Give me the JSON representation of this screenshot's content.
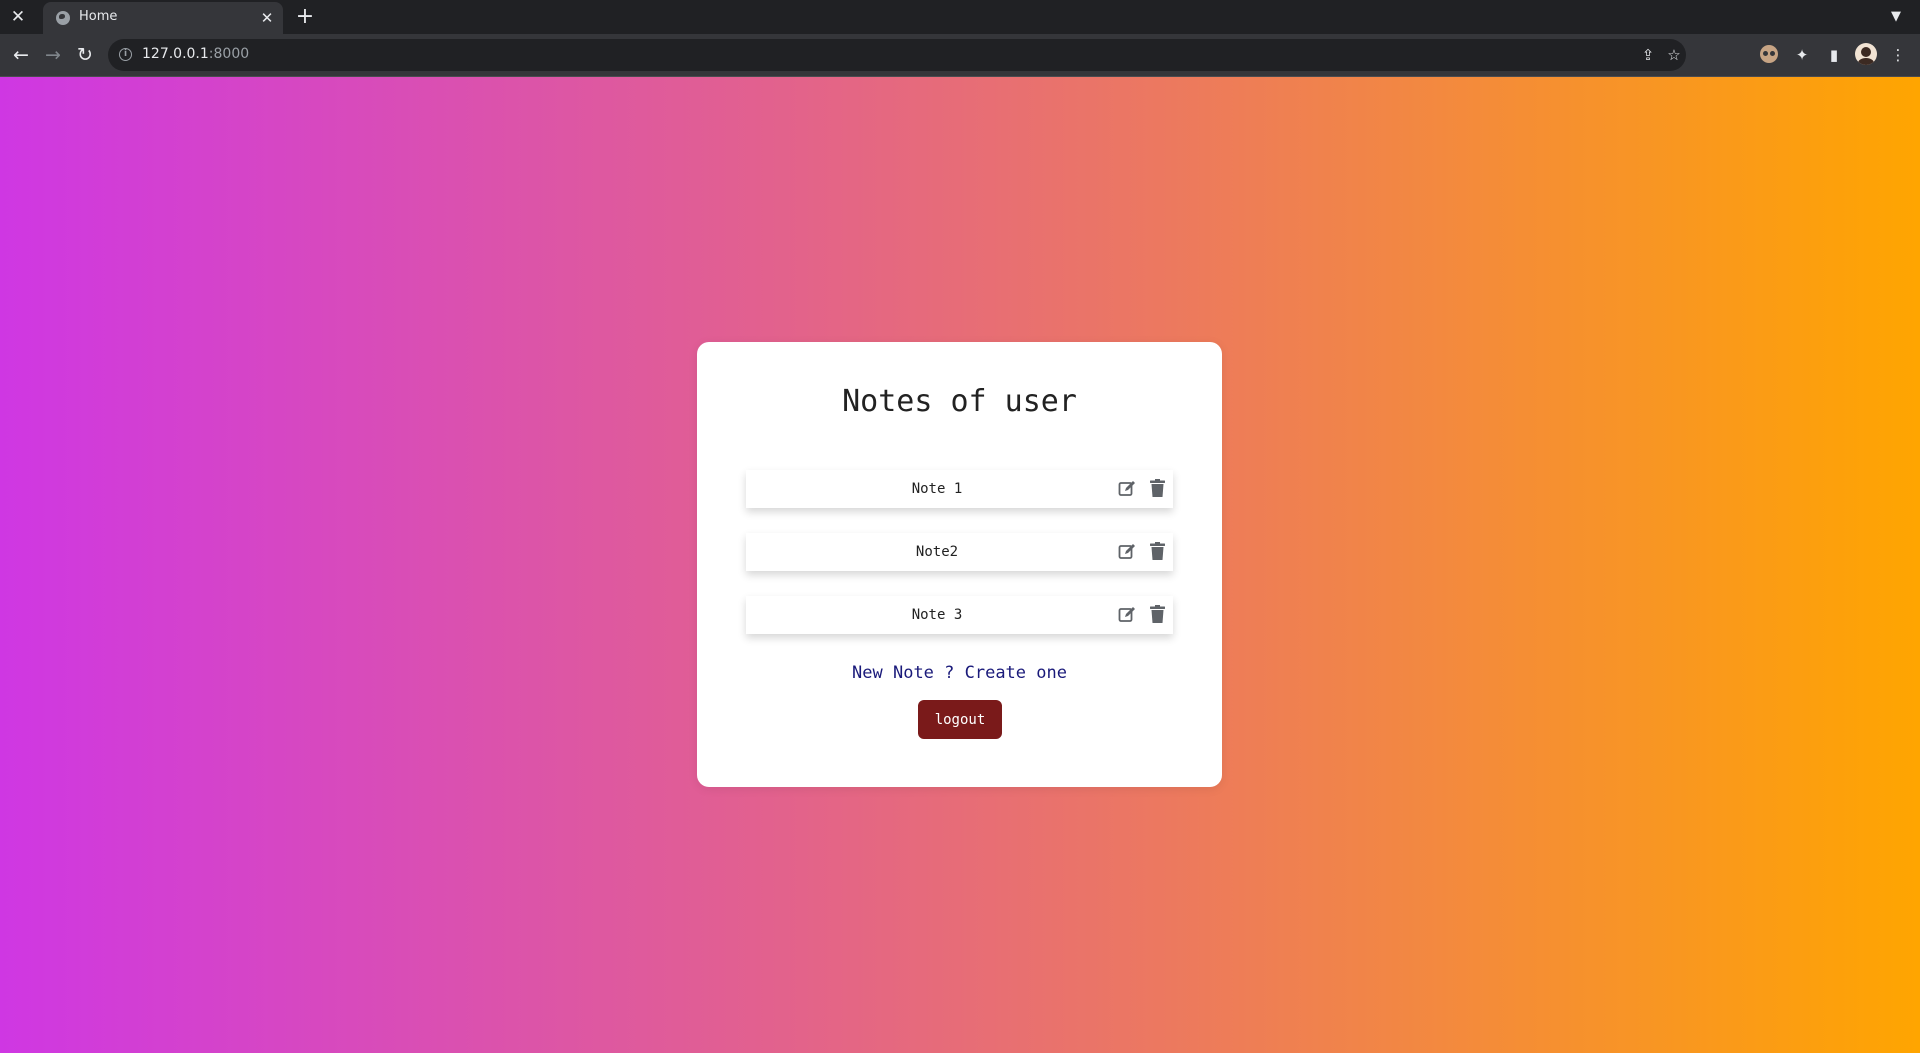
{
  "browser": {
    "tab_title": "Home",
    "url_host": "127.0.0.1",
    "url_port": ":8000",
    "icons": {
      "window_close": "close-icon",
      "tab_close": "close-icon",
      "new_tab": "plus-icon",
      "tab_search": "chevron-down-icon",
      "back": "arrow-left-icon",
      "forward": "arrow-right-icon",
      "reload": "reload-icon",
      "site_info": "info-icon",
      "share": "share-icon",
      "bookmark": "star-icon",
      "extension": "extension-face-icon",
      "extensions": "puzzle-icon",
      "side_panel": "side-panel-icon",
      "profile": "avatar",
      "menu": "kebab-menu-icon"
    }
  },
  "page": {
    "background_colors": [
      "#cf37e3",
      "#e2618e",
      "#f3893f",
      "#ffa500"
    ],
    "title": "Notes of user",
    "notes": [
      {
        "label": "Note 1"
      },
      {
        "label": "Note2"
      },
      {
        "label": "Note 3"
      }
    ],
    "create_link": "New Note ? Create one",
    "logout_label": "logout",
    "colors": {
      "logout_bg": "#7a1a1a",
      "link": "#1a1a7a",
      "icon": "#5f6368"
    }
  }
}
